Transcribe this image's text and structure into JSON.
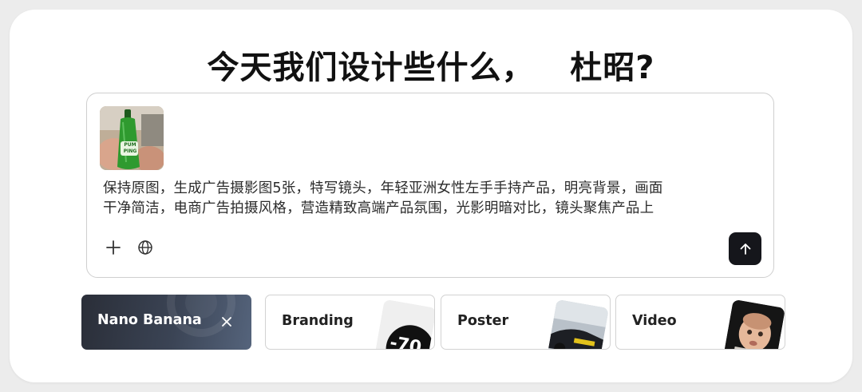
{
  "header": {
    "title": "今天我们设计些什么，   杜昭?"
  },
  "composer": {
    "attachment": {
      "label_line1": "PUM",
      "label_line2": "PING"
    },
    "prompt_line1": "保持原图，生成广告摄影图5张，特写镜头，年轻亚洲女性左手手持产品，明亮背景，画面",
    "prompt_line2": "干净简洁，电商广告拍摄风格，营造精致高端产品氛围，光影明暗对比，镜头聚焦产品上",
    "tools": [
      {
        "name": "add",
        "icon": "plus-icon"
      },
      {
        "name": "web",
        "icon": "globe-icon"
      }
    ],
    "send_icon": "arrow-up-icon"
  },
  "modes": [
    {
      "label": "Nano Banana",
      "active": true,
      "close_icon": "close-icon"
    },
    {
      "label": "Branding",
      "active": false,
      "thumb_text": "-70"
    },
    {
      "label": "Poster",
      "active": false
    },
    {
      "label": "Video",
      "active": false
    }
  ],
  "colors": {
    "accent_dark": "#15161b",
    "active_chip_start": "#2a2e38",
    "active_chip_end": "#55647c",
    "border": "#cfcfcf"
  }
}
